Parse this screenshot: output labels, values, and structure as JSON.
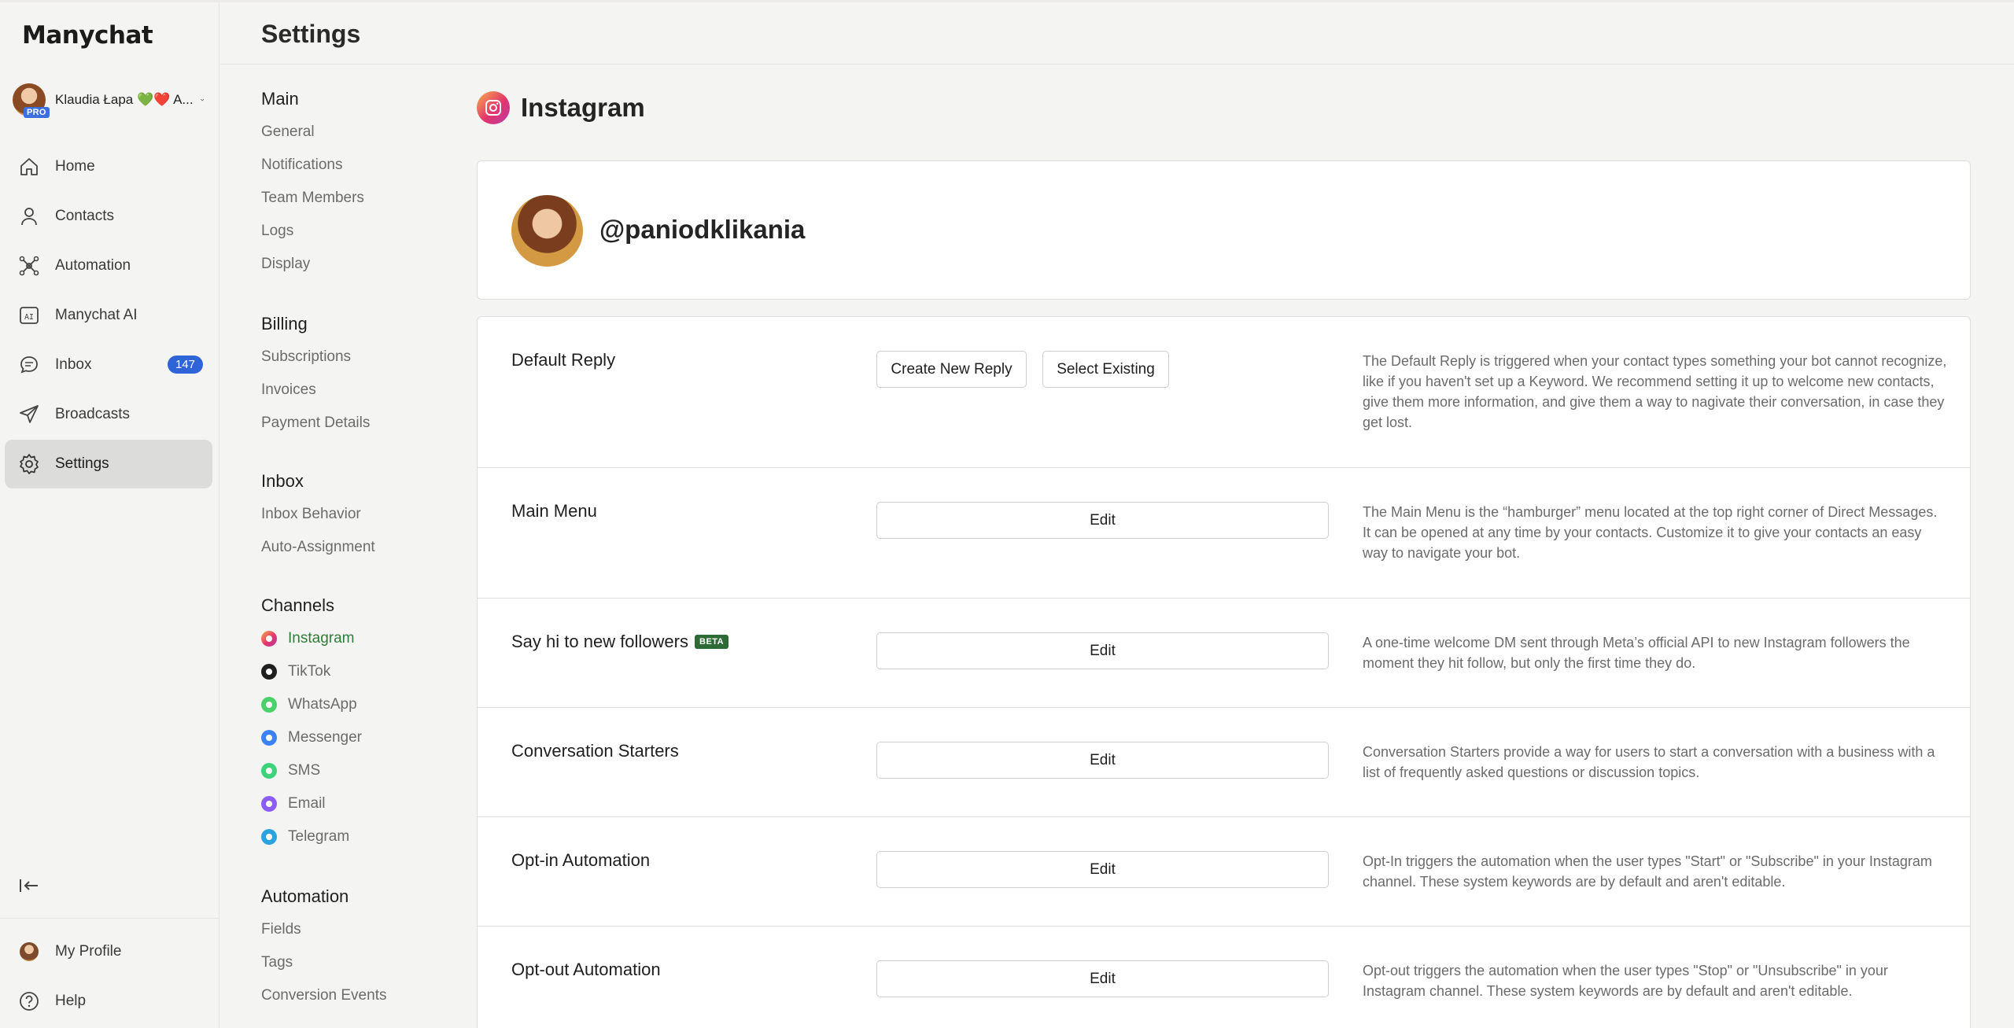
{
  "app": {
    "logo": "Manychat"
  },
  "account": {
    "name": "Klaudia Łapa 💚❤️ A...",
    "badge": "PRO"
  },
  "nav": [
    {
      "label": "Home",
      "icon": "home-icon"
    },
    {
      "label": "Contacts",
      "icon": "person-icon"
    },
    {
      "label": "Automation",
      "icon": "automation-icon"
    },
    {
      "label": "Manychat AI",
      "icon": "ai-icon"
    },
    {
      "label": "Inbox",
      "icon": "chat-bubble-icon",
      "badge": "147"
    },
    {
      "label": "Broadcasts",
      "icon": "paper-plane-icon"
    },
    {
      "label": "Settings",
      "icon": "gear-icon",
      "active": true
    }
  ],
  "bottom_nav": [
    {
      "label": "My Profile",
      "icon": "avatar"
    },
    {
      "label": "Help",
      "icon": "help-icon"
    }
  ],
  "header": {
    "title": "Settings"
  },
  "submenu": {
    "main": {
      "title": "Main",
      "items": [
        "General",
        "Notifications",
        "Team Members",
        "Logs",
        "Display"
      ]
    },
    "billing": {
      "title": "Billing",
      "items": [
        "Subscriptions",
        "Invoices",
        "Payment Details"
      ]
    },
    "inbox": {
      "title": "Inbox",
      "items": [
        "Inbox Behavior",
        "Auto-Assignment"
      ]
    },
    "channels": {
      "title": "Channels",
      "items": [
        {
          "label": "Instagram",
          "color": "#e1306c",
          "active": true
        },
        {
          "label": "TikTok",
          "color": "#1f1f1f"
        },
        {
          "label": "WhatsApp",
          "color": "#4bd16a"
        },
        {
          "label": "Messenger",
          "color": "#3b82f6"
        },
        {
          "label": "SMS",
          "color": "#3ed27a"
        },
        {
          "label": "Email",
          "color": "#8b5cf6"
        },
        {
          "label": "Telegram",
          "color": "#2aa3e0"
        }
      ]
    },
    "automation": {
      "title": "Automation",
      "items": [
        "Fields",
        "Tags",
        "Conversion Events"
      ]
    }
  },
  "channel": {
    "title": "Instagram",
    "handle": "@paniodklikania"
  },
  "rows": [
    {
      "title": "Default Reply",
      "buttons": [
        "Create New Reply",
        "Select Existing"
      ],
      "desc": "The Default Reply is triggered when your contact types something your bot cannot recognize, like if you haven't set up a Keyword. We recommend setting it up to welcome new contacts, give them more information, and give them a way to nagivate their conversation, in case they get lost."
    },
    {
      "title": "Main Menu",
      "button": "Edit",
      "desc": "The Main Menu is the “hamburger” menu located at the top right corner of Direct Messages. It can be opened at any time by your contacts. Customize it to give your contacts an easy way to navigate your bot."
    },
    {
      "title": "Say hi to new followers",
      "badge": "BETA",
      "button": "Edit",
      "desc": "A one-time welcome DM sent through Meta’s official API to new Instagram followers the moment they hit follow, but only the first time they do."
    },
    {
      "title": "Conversation Starters",
      "button": "Edit",
      "desc": "Conversation Starters provide a way for users to start a conversation with a business with a list of frequently asked questions or discussion topics."
    },
    {
      "title": "Opt-in Automation",
      "button": "Edit",
      "desc": "Opt-In triggers the automation when the user types \"Start\" or \"Subscribe\" in your Instagram channel. These system keywords are by default and aren't editable."
    },
    {
      "title": "Opt-out Automation",
      "button": "Edit",
      "desc": "Opt-out triggers the automation when the user types \"Stop\" or \"Unsubscribe\" in your Instagram channel. These system keywords are by default and aren't editable."
    }
  ]
}
